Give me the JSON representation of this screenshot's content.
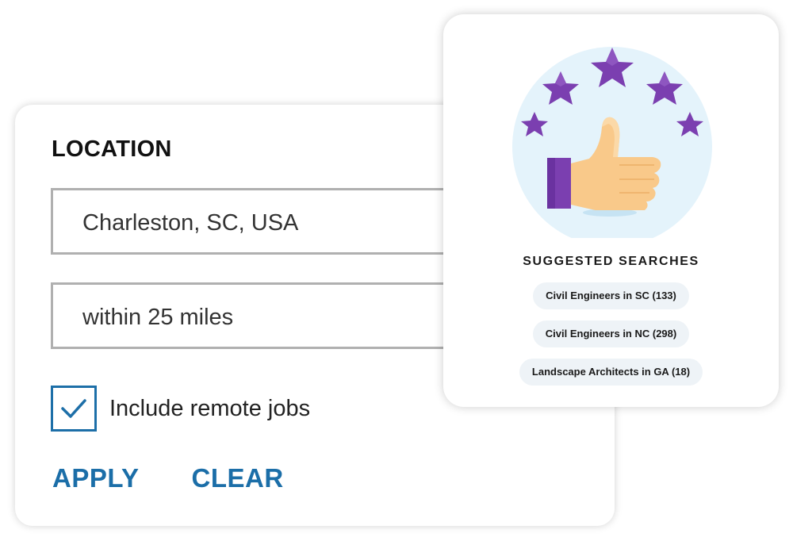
{
  "location": {
    "title": "LOCATION",
    "location_value": "Charleston, SC, USA",
    "radius_value": "within 25 miles",
    "remote_label": "Include remote jobs",
    "remote_checked": true,
    "apply_label": "APPLY",
    "clear_label": "CLEAR"
  },
  "suggested": {
    "title": "SUGGESTED SEARCHES",
    "illustration_icon": "thumbs-up-with-stars",
    "searches": [
      {
        "label": "Civil Engineers in SC (133)"
      },
      {
        "label": "Civil Engineers in NC (298)"
      },
      {
        "label": "Landscape Architects in GA (18)"
      }
    ]
  },
  "colors": {
    "accent": "#1b6ea8",
    "star": "#7b3fb0",
    "circle": "#e4f3fb",
    "chip_bg": "#eef3f7"
  }
}
